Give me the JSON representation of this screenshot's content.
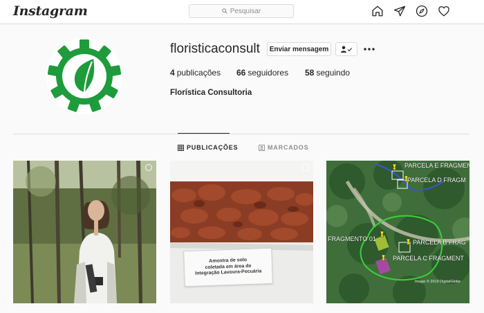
{
  "header": {
    "logo": "Instagram",
    "search_placeholder": "Pesquisar",
    "icons": [
      "home-icon",
      "direct-icon",
      "explore-icon",
      "activity-icon"
    ]
  },
  "profile": {
    "username": "floristicaconsult",
    "message_button": "Enviar mensagem",
    "full_name": "Florística Consultoria",
    "stats": {
      "posts_count": "4",
      "posts_label": "publicações",
      "followers_count": "66",
      "followers_label": "seguidores",
      "following_count": "58",
      "following_label": "seguindo"
    }
  },
  "tabs": [
    {
      "label": "PUBLICAÇÕES",
      "active": true
    },
    {
      "label": "MARCADOS",
      "active": false
    }
  ],
  "posts": [
    {
      "kind": "video",
      "badge": "video-icon"
    },
    {
      "kind": "carousel",
      "badge": "carousel-icon",
      "caption_line1": "Amostra de solo",
      "caption_line2": "coletada em área de",
      "caption_line3": "Integração Lavoura-Pecuária"
    },
    {
      "kind": "map",
      "labels": [
        "PARCELA E FRAGMENT",
        "PARCELA D FRAGM",
        "FRAGMENTO 01",
        "PARCELA B FRAG",
        "PARCELA C FRAGMENT"
      ],
      "copyright": "Image © 2019 DigitalGlobe"
    }
  ],
  "colors": {
    "brand_green": "#1e9b3b",
    "text": "#262626",
    "muted": "#8e8e8e",
    "border": "#dbdbdb"
  }
}
